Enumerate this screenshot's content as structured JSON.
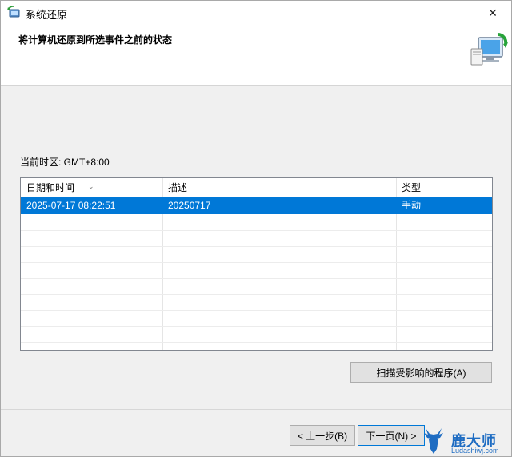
{
  "window": {
    "title": "系统还原",
    "close_glyph": "✕"
  },
  "header": {
    "heading": "将计算机还原到所选事件之前的状态"
  },
  "timezone_label": "当前时区: GMT+8:00",
  "table": {
    "columns": [
      "日期和时间",
      "描述",
      "类型"
    ],
    "rows": [
      {
        "datetime": "2025-07-17 08:22:51",
        "description": "20250717",
        "type": "手动",
        "selected": true
      }
    ]
  },
  "buttons": {
    "scan": "扫描受影响的程序(A)",
    "back": "< 上一步(B)",
    "next": "下一页(N) >"
  },
  "watermark": {
    "brand": "鹿大师",
    "url": "Ludashiwj.com"
  },
  "colors": {
    "selection": "#0078d7",
    "watermark": "#1e6cc2"
  }
}
